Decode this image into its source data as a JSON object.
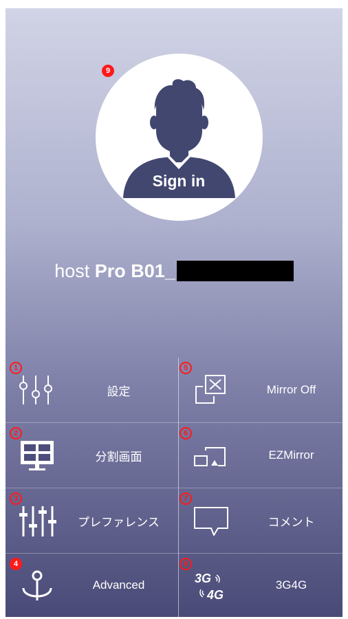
{
  "profile": {
    "marker": "9",
    "sign_in_label": "Sign in",
    "avatar_icon": "person-silhouette-icon"
  },
  "host": {
    "prefix": "host",
    "model": "Pro B01_"
  },
  "menu": {
    "items": [
      {
        "marker": "1",
        "label": "設定",
        "icon": "sliders-icon"
      },
      {
        "marker": "5",
        "label": "Mirror Off",
        "icon": "mirror-off-icon"
      },
      {
        "marker": "2",
        "label": "分割画面",
        "icon": "split-screen-icon"
      },
      {
        "marker": "6",
        "label": "EZMirror",
        "icon": "ezmirror-cast-icon"
      },
      {
        "marker": "3",
        "label": "プレファレンス",
        "icon": "equalizer-icon"
      },
      {
        "marker": "7",
        "label": "コメント",
        "icon": "comment-icon"
      },
      {
        "marker": "4",
        "label": "Advanced",
        "icon": "anchor-icon"
      },
      {
        "marker": "8",
        "label": "3G4G",
        "icon": "3g4g-icon"
      }
    ]
  },
  "icon_glyphs": {
    "3g": "3G",
    "4g": "4G"
  },
  "colors": {
    "marker_red": "#ff1a1a",
    "gradient_top": "#d1d4e6",
    "gradient_bottom": "#4a4a78",
    "text": "#ffffff"
  }
}
